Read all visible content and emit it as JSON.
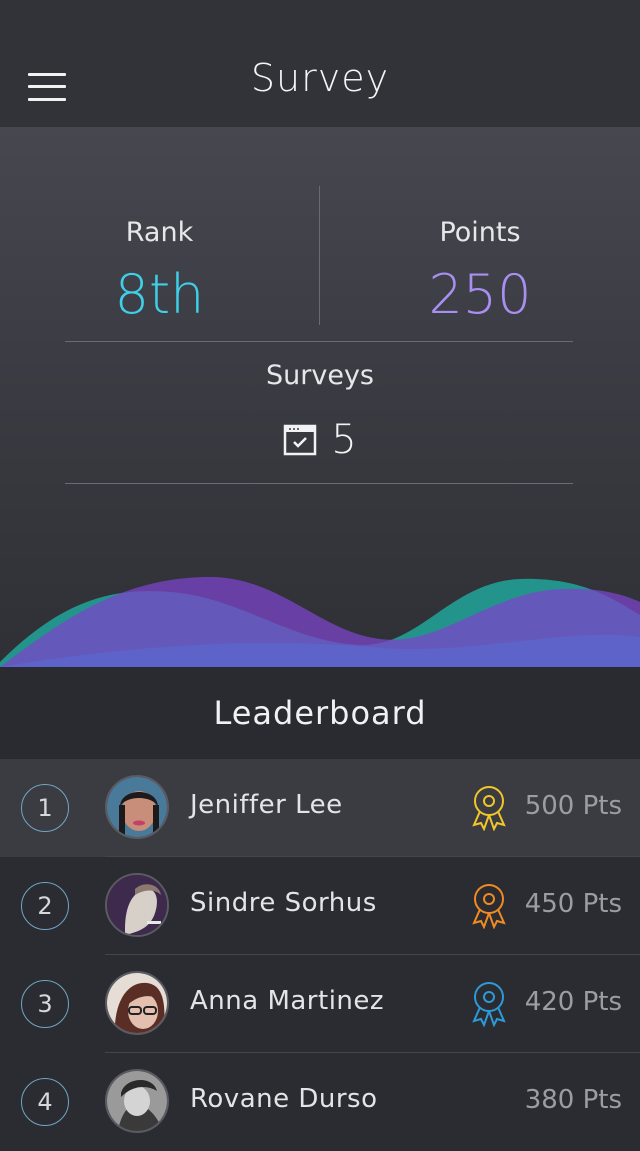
{
  "header": {
    "title": "Survey",
    "menu_icon": "hamburger-menu-icon"
  },
  "stats": {
    "rank_label": "Rank",
    "rank_value": "8th",
    "rank_color": "#3fd0e8",
    "points_label": "Points",
    "points_value": "250",
    "points_color": "#a98ff0",
    "surveys_label": "Surveys",
    "surveys_value": "5",
    "surveys_icon": "calendar-check-icon"
  },
  "wave_colors": [
    "#1fb5a8",
    "#7b45c9",
    "#5a6ad6"
  ],
  "leaderboard": {
    "title": "Leaderboard",
    "entries": [
      {
        "rank": "1",
        "name": "Jeniffer Lee",
        "points": "500 Pts",
        "medal_color": "#f1c62a",
        "medal_icon": "award-ribbon-icon"
      },
      {
        "rank": "2",
        "name": "Sindre Sorhus",
        "points": "450 Pts",
        "medal_color": "#f08a24",
        "medal_icon": "award-ribbon-icon"
      },
      {
        "rank": "3",
        "name": "Anna Martinez",
        "points": "420 Pts",
        "medal_color": "#2d9ad8",
        "medal_icon": "award-ribbon-icon"
      },
      {
        "rank": "4",
        "name": "Rovane Durso",
        "points": "380 Pts"
      }
    ]
  }
}
